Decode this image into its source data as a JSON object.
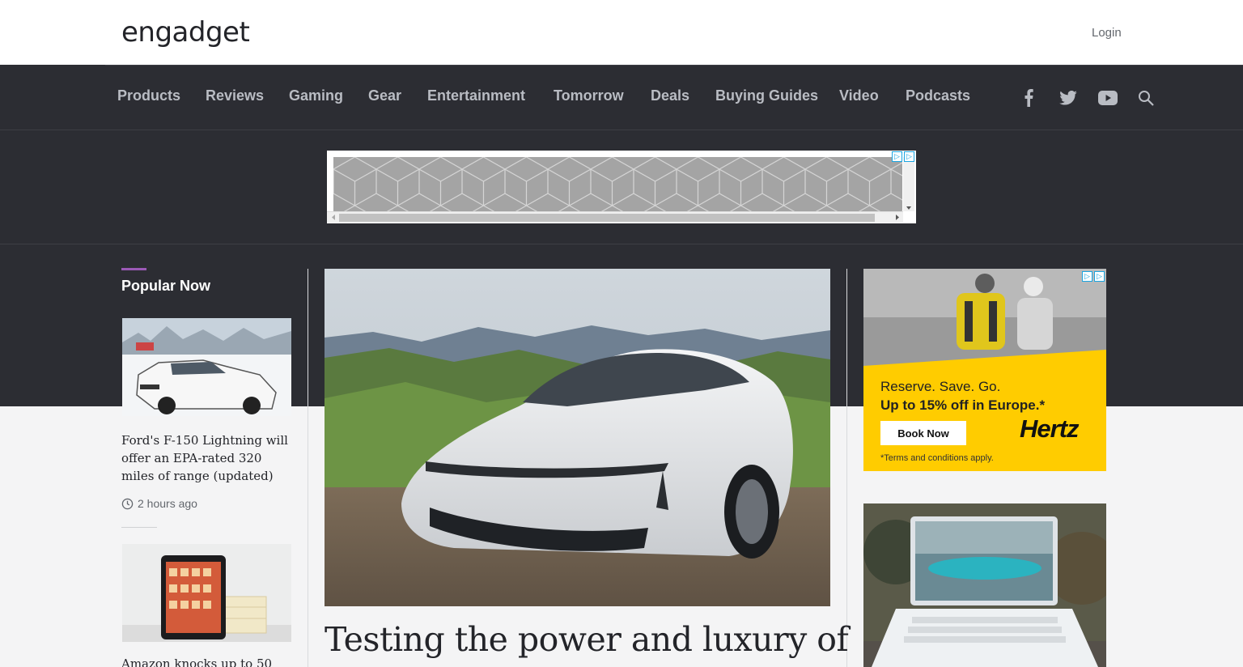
{
  "header": {
    "logo": "engadget",
    "login": "Login"
  },
  "nav": {
    "items": [
      "Products",
      "Reviews",
      "Gaming",
      "Gear",
      "Entertainment",
      "Tomorrow",
      "Deals",
      "Buying Guides",
      "Video",
      "Podcasts"
    ],
    "icons": [
      "facebook-icon",
      "twitter-icon",
      "youtube-icon",
      "search-icon"
    ]
  },
  "popular": {
    "title": "Popular Now",
    "stories": [
      {
        "title": "Ford's F-150 Lightning will offer an EPA-rated 320 miles of range (updated)",
        "time": "2 hours ago"
      },
      {
        "title": "Amazon knocks up to 50"
      }
    ]
  },
  "hero": {
    "title": "Testing the power and luxury of"
  },
  "ads": {
    "hertz": {
      "line1": "Reserve. Save. Go.",
      "line2": "Up to 15% off in Europe.*",
      "button": "Book Now",
      "logo": "Hertz",
      "terms": "*Terms and conditions apply."
    }
  },
  "colors": {
    "nav_bg": "#2c2d33",
    "accent": "#9b59b6",
    "hertz_yellow": "#ffcc00"
  }
}
